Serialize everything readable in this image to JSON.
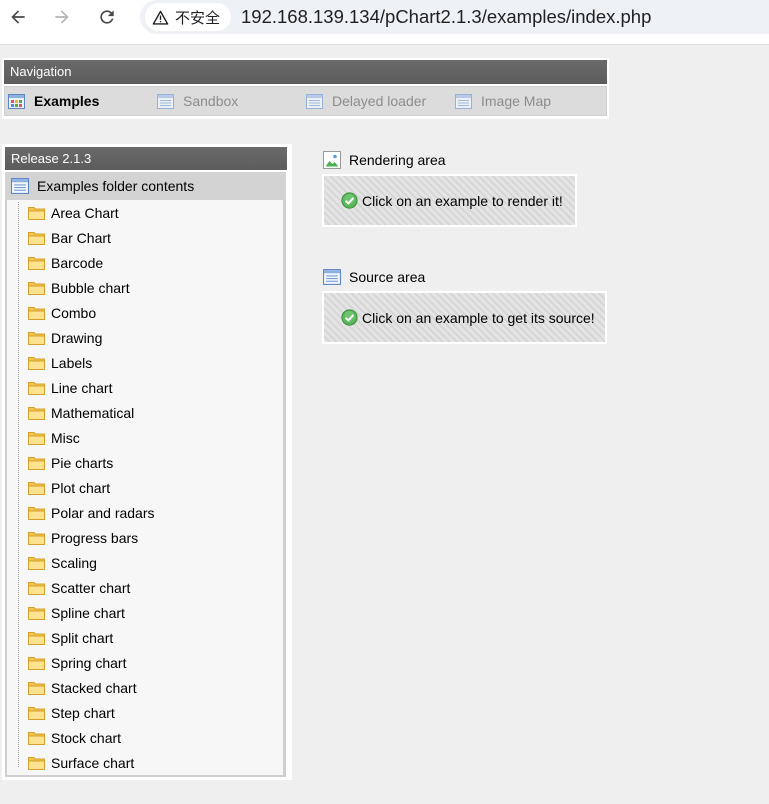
{
  "browser": {
    "security_label": "不安全",
    "url": "192.168.139.134/pChart2.1.3/examples/index.php"
  },
  "navigation": {
    "title": "Navigation",
    "tabs": [
      {
        "label": "Examples",
        "icon": "examples-grid-icon",
        "active": true
      },
      {
        "label": "Sandbox",
        "icon": "window-list-icon",
        "active": false
      },
      {
        "label": "Delayed loader",
        "icon": "window-list-icon",
        "active": false
      },
      {
        "label": "Image Map",
        "icon": "window-list-icon",
        "active": false
      }
    ]
  },
  "release": {
    "title": "Release 2.1.3",
    "folder_label": "Examples folder contents",
    "folder_icon": "window-list-icon",
    "item_icon": "folder-icon",
    "items": [
      "Area Chart",
      "Bar Chart",
      "Barcode",
      "Bubble chart",
      "Combo",
      "Drawing",
      "Labels",
      "Line chart",
      "Mathematical",
      "Misc",
      "Pie charts",
      "Plot chart",
      "Polar and radars",
      "Progress bars",
      "Scaling",
      "Scatter chart",
      "Spline chart",
      "Split chart",
      "Spring chart",
      "Stacked chart",
      "Step chart",
      "Stock chart",
      "Surface chart"
    ]
  },
  "rendering": {
    "title": "Rendering area",
    "icon": "image-icon",
    "message": "Click on an example to render it!",
    "status_icon": "check-circle-icon"
  },
  "source": {
    "title": "Source area",
    "icon": "window-list-icon",
    "message": "Click on an example to get its source!",
    "status_icon": "check-circle-icon"
  },
  "colors": {
    "page_background": "#efefef",
    "header_bar": "#5c5c5c",
    "tab_row": "#dcdcdc",
    "inactive_tab_text": "#8c8c8c",
    "status_ok": "#4cae4c"
  }
}
